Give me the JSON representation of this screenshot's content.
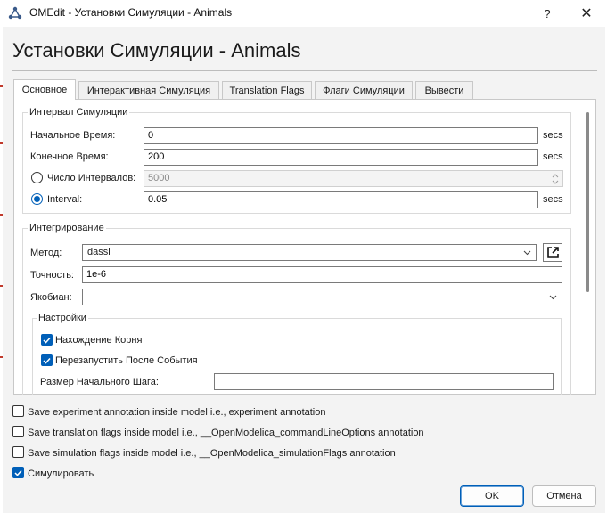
{
  "window": {
    "title": "OMEdit - Установки Симуляции - Animals",
    "help": "?",
    "close": "✕"
  },
  "dialog": {
    "heading": "Установки Симуляции - Animals"
  },
  "tabs": [
    {
      "label": "Основное",
      "active": true
    },
    {
      "label": "Интерактивная Симуляция",
      "active": false
    },
    {
      "label": "Translation Flags",
      "active": false
    },
    {
      "label": "Флаги Симуляции",
      "active": false
    },
    {
      "label": "Вывести",
      "active": false
    }
  ],
  "interval": {
    "title": "Интервал Симуляции",
    "start_label": "Начальное Время:",
    "start_value": "0",
    "start_unit": "secs",
    "stop_label": "Конечное Время:",
    "stop_value": "200",
    "stop_unit": "secs",
    "num_intervals_label": "Число Интервалов:",
    "num_intervals_value": "5000",
    "num_intervals_selected": false,
    "interval_label": "Interval:",
    "interval_value": "0.05",
    "interval_unit": "secs",
    "interval_selected": true
  },
  "integration": {
    "title": "Интегрирование",
    "method_label": "Метод:",
    "method_value": "dassl",
    "tolerance_label": "Точность:",
    "tolerance_value": "1e-6",
    "jacobian_label": "Якобиан:",
    "jacobian_value": "",
    "settings": {
      "title": "Настройки",
      "root_finding_label": "Нахождение Корня",
      "root_finding_checked": true,
      "restart_after_event_label": "Перезапустить После События",
      "restart_after_event_checked": true,
      "initial_step_label": "Размер Начального Шага:",
      "initial_step_value": ""
    }
  },
  "options": {
    "save_experiment": {
      "label": "Save experiment annotation inside model i.e., experiment annotation",
      "checked": false
    },
    "save_translation": {
      "label": "Save translation flags inside model i.e., __OpenModelica_commandLineOptions annotation",
      "checked": false
    },
    "save_simulation": {
      "label": "Save simulation flags inside model i.e., __OpenModelica_simulationFlags annotation",
      "checked": false
    },
    "simulate": {
      "label": "Симулировать",
      "checked": true
    }
  },
  "buttons": {
    "ok": "OK",
    "cancel": "Отмена"
  },
  "colors": {
    "accent": "#005fb8",
    "dialog_bg": "#f3f3f3"
  }
}
